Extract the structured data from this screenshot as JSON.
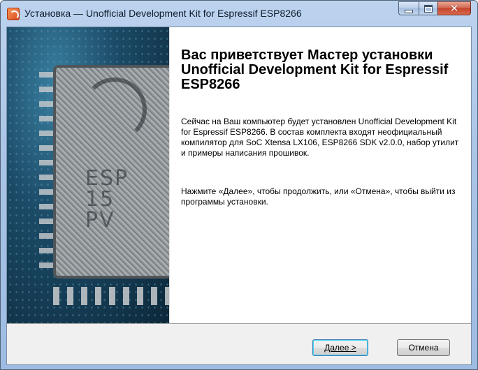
{
  "window": {
    "title": "Установка — Unofficial Development Kit for Espressif ESP8266",
    "icon": "installer-icon"
  },
  "banner": {
    "chip_marking": [
      "ESP",
      "15",
      "PV"
    ]
  },
  "content": {
    "heading": "Вас приветствует Мастер установки Unofficial Development Kit for Espressif ESP8266",
    "paragraph1": "Сейчас на Ваш компьютер будет установлен Unofficial Development Kit for Espressif ESP8266. В состав комплекта входят неофициальный компилятор для SoC Xtensa LX106, ESP8266 SDK v2.0.0, набор утилит и примеры написания прошивок.",
    "paragraph2": "Нажмите «Далее», чтобы продолжить, или «Отмена», чтобы выйти из программы установки."
  },
  "buttons": {
    "next_label": "Далее >",
    "cancel_label": "Отмена"
  },
  "colors": {
    "titlebar": "#a9c4e6",
    "close_button": "#c4432b",
    "footer": "#f0f0f0",
    "default_button_border": "#3c7fb1"
  }
}
